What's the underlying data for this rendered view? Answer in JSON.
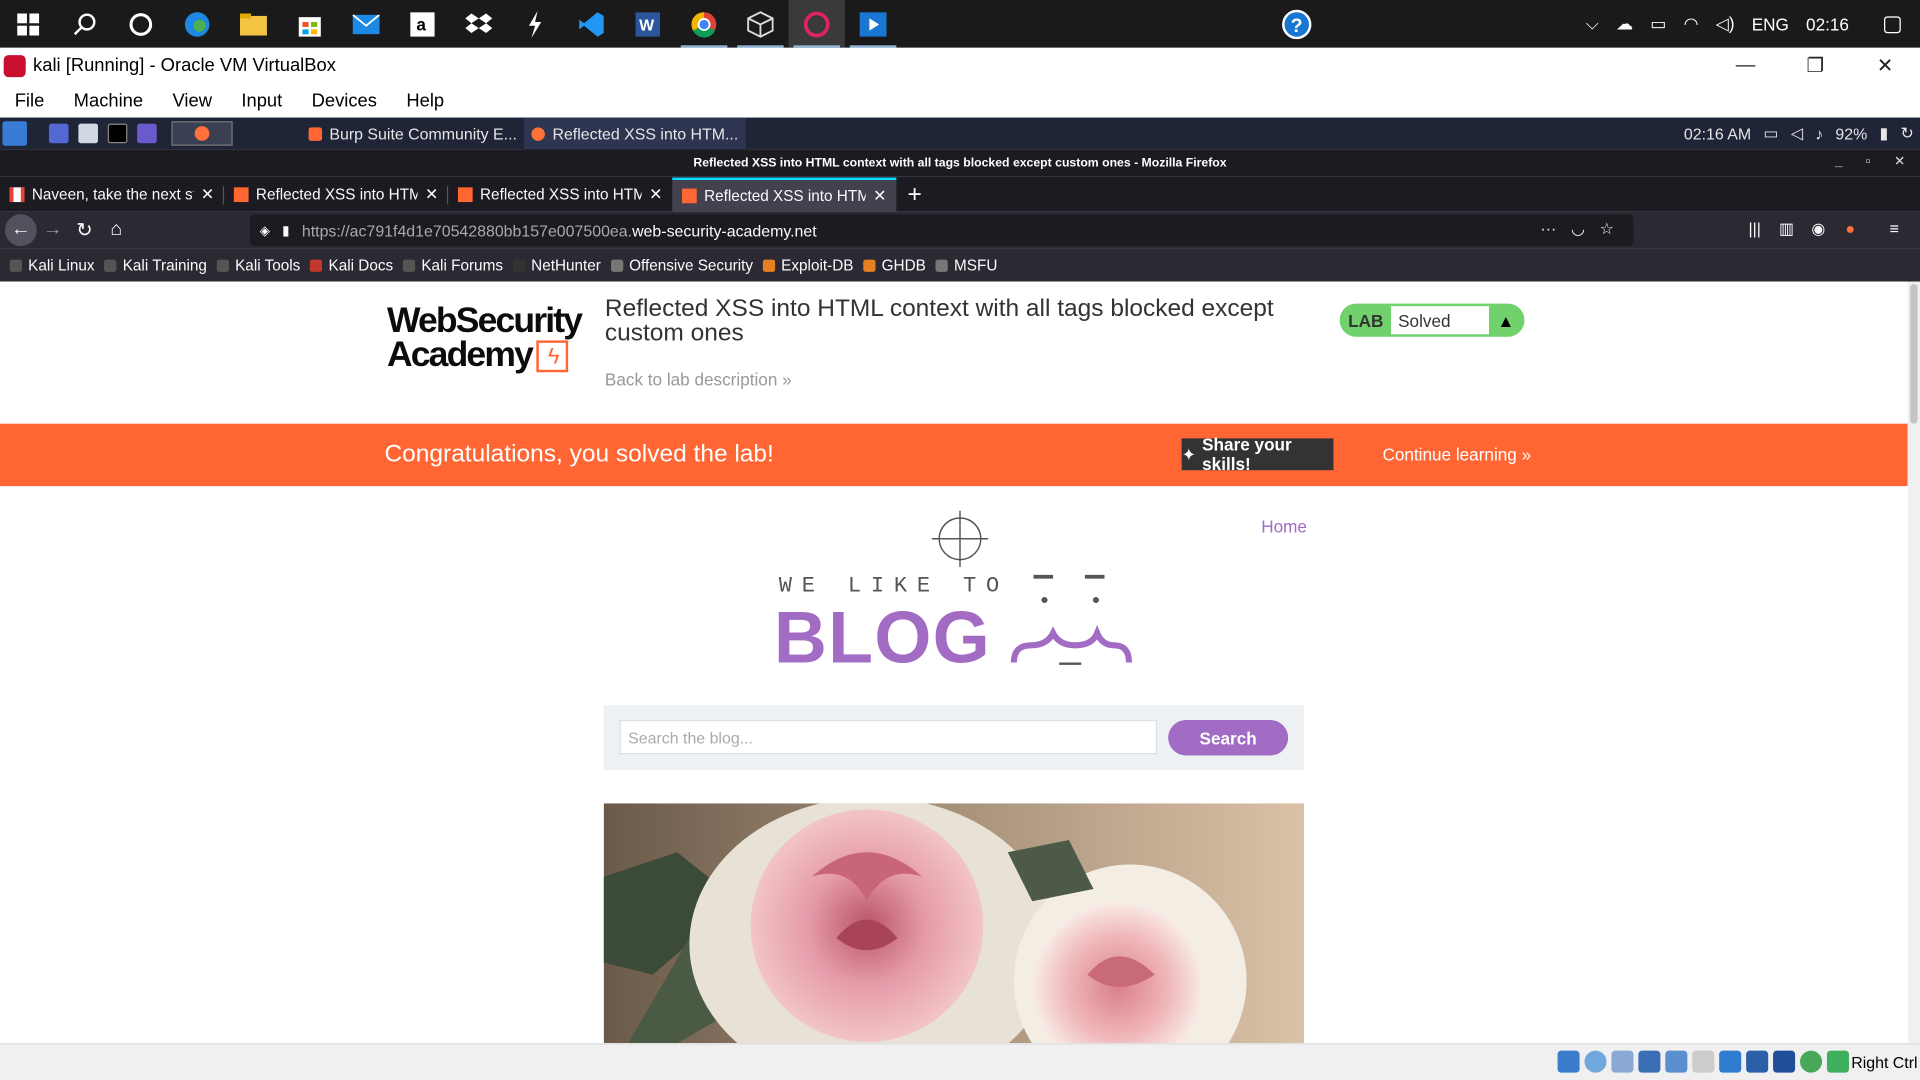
{
  "windows_taskbar": {
    "language": "ENG",
    "clock": "02:16"
  },
  "vbox": {
    "title": "kali [Running] - Oracle VM VirtualBox",
    "menu": [
      "File",
      "Machine",
      "View",
      "Input",
      "Devices",
      "Help"
    ],
    "host_key_label": "Right Ctrl"
  },
  "kali_panel": {
    "tasks": [
      {
        "label": "Burp Suite Community E..."
      },
      {
        "label": "Reflected XSS into HTM..."
      }
    ],
    "time": "02:16 AM",
    "battery": "92%"
  },
  "firefox": {
    "window_title": "Reflected XSS into HTML context with all tags blocked except custom ones - Mozilla Firefox",
    "tabs": [
      {
        "label": "Naveen, take the next ste",
        "selected": false
      },
      {
        "label": "Reflected XSS into HTML",
        "selected": false
      },
      {
        "label": "Reflected XSS into HTML",
        "selected": false
      },
      {
        "label": "Reflected XSS into HTML",
        "selected": true
      }
    ],
    "url_prefix": "https://ac791f4d1e70542880bb157e007500ea.",
    "url_domain": "web-security-academy.net",
    "bookmarks": [
      "Kali Linux",
      "Kali Training",
      "Kali Tools",
      "Kali Docs",
      "Kali Forums",
      "NetHunter",
      "Offensive Security",
      "Exploit-DB",
      "GHDB",
      "MSFU"
    ]
  },
  "lab": {
    "logo_line1": "WebSecurity",
    "logo_line2": "Academy",
    "title": "Reflected XSS into HTML context with all tags blocked except custom ones",
    "back_link": "Back to lab description »",
    "badge_label": "LAB",
    "status": "Solved"
  },
  "banner": {
    "message": "Congratulations, you solved the lab!",
    "share_label": "Share your skills!",
    "continue_label": "Continue learning »"
  },
  "blog": {
    "home_link": "Home",
    "tagline": "WE LIKE TO",
    "wordmark": "BLOG",
    "search_placeholder": "Search the blog...",
    "search_button": "Search"
  },
  "colors": {
    "accent_orange": "#ff6633",
    "lab_green": "#70d16d",
    "blog_purple": "#a36cc4",
    "firefox_dark": "#1c1b22"
  }
}
